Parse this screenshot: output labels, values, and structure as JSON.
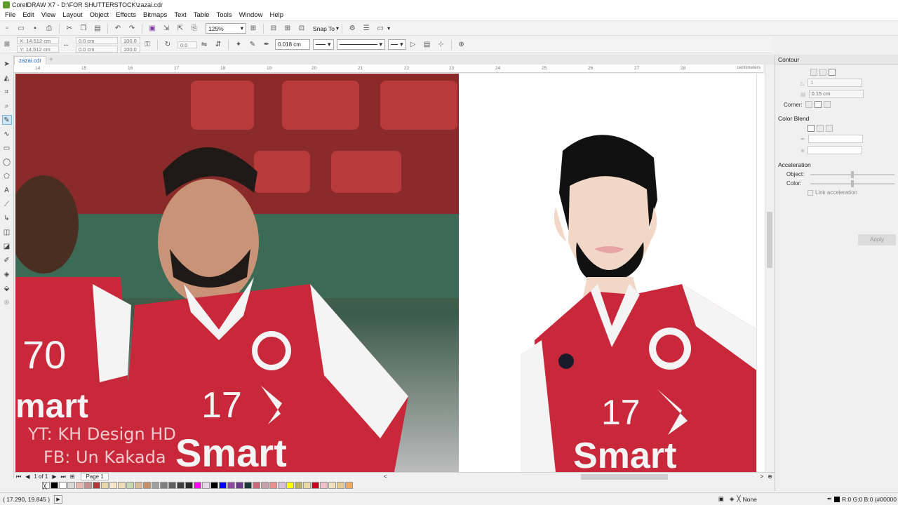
{
  "window": {
    "title": "CorelDRAW X7 - D:\\FOR SHUTTERSTOCK\\zazai.cdr"
  },
  "menu": [
    "File",
    "Edit",
    "View",
    "Layout",
    "Object",
    "Effects",
    "Bitmaps",
    "Text",
    "Table",
    "Tools",
    "Window",
    "Help"
  ],
  "toolbar": {
    "zoom": "125%",
    "snap_label": "Snap To"
  },
  "propbar": {
    "x": "X: 14.512 cm",
    "y": "Y: 14.512 cm",
    "w": "0.0 cm",
    "h": "0.0 cm",
    "sx": "100.0",
    "sy": "100.0",
    "angle": "0.0",
    "outline_width": "0.018 cm"
  },
  "document": {
    "tab": "zazai.cdr",
    "ruler_unit": "centimeters",
    "ruler_ticks": [
      "14",
      "15",
      "16",
      "17",
      "18",
      "19",
      "20",
      "21",
      "22",
      "23",
      "24",
      "25",
      "26",
      "27",
      "28"
    ]
  },
  "canvas": {
    "watermark_line1": "YT: KH Design HD",
    "watermark_line2": "FB: Un Kakada",
    "jersey_number": "17",
    "sponsor": "Smart",
    "left_number": "70",
    "left_sponsor": "mart"
  },
  "pager": {
    "count": "1 of 1",
    "page_tab": "Page 1"
  },
  "palette": [
    "#000000",
    "#ffffff",
    "#d8d8d8",
    "#e7b9b0",
    "#c89090",
    "#b03a3a",
    "#e8d7a8",
    "#f5e6c8",
    "#eeddb8",
    "#c8d7b0",
    "#d8b896",
    "#c8906a",
    "#a0a0a0",
    "#808080",
    "#606060",
    "#404040",
    "#2a2a2a",
    "#ff00ff",
    "#e8d8e8",
    "#000000",
    "#0000ff",
    "#8a4aa0",
    "#6a3a8a",
    "#1a3a3a",
    "#c86a7a",
    "#c8a0a8",
    "#e89090",
    "#d8c0d8",
    "#ffff00",
    "#b8b060",
    "#e8d8a8",
    "#d00020",
    "#f0c0c8",
    "#f0e0c0",
    "#e8c890",
    "#f0a860"
  ],
  "status": {
    "coords": "( 17.290, 19.845 )",
    "fill_label": "None",
    "color_readout": "R:0 G:0 B:0 (#00000"
  },
  "docker": {
    "title": "Contour",
    "steps": "1",
    "offset": "0.15 cm",
    "corner_label": "Corner:",
    "color_blend": "Color Blend",
    "acceleration": "Acceleration",
    "object_label": "Object:",
    "color_label": "Color:",
    "link_label": "Link acceleration",
    "apply": "Apply"
  }
}
